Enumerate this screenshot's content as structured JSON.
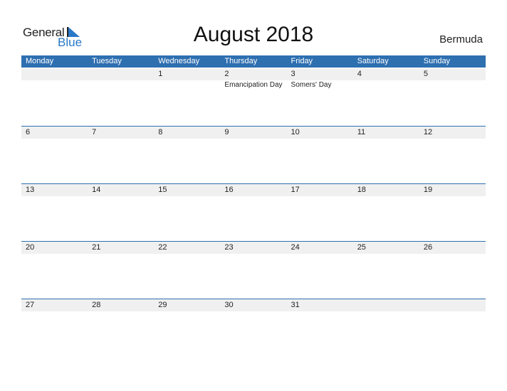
{
  "logo": {
    "word1": "General",
    "word2": "Blue"
  },
  "title": "August 2018",
  "country": "Bermuda",
  "colors": {
    "accent": "#2e6fb0",
    "strip": "#f0f0f0"
  },
  "weekdays": [
    "Monday",
    "Tuesday",
    "Wednesday",
    "Thursday",
    "Friday",
    "Saturday",
    "Sunday"
  ],
  "weeks": [
    [
      {
        "day": ""
      },
      {
        "day": ""
      },
      {
        "day": "1"
      },
      {
        "day": "2",
        "event": "Emancipation Day"
      },
      {
        "day": "3",
        "event": "Somers' Day"
      },
      {
        "day": "4"
      },
      {
        "day": "5"
      }
    ],
    [
      {
        "day": "6"
      },
      {
        "day": "7"
      },
      {
        "day": "8"
      },
      {
        "day": "9"
      },
      {
        "day": "10"
      },
      {
        "day": "11"
      },
      {
        "day": "12"
      }
    ],
    [
      {
        "day": "13"
      },
      {
        "day": "14"
      },
      {
        "day": "15"
      },
      {
        "day": "16"
      },
      {
        "day": "17"
      },
      {
        "day": "18"
      },
      {
        "day": "19"
      }
    ],
    [
      {
        "day": "20"
      },
      {
        "day": "21"
      },
      {
        "day": "22"
      },
      {
        "day": "23"
      },
      {
        "day": "24"
      },
      {
        "day": "25"
      },
      {
        "day": "26"
      }
    ],
    [
      {
        "day": "27"
      },
      {
        "day": "28"
      },
      {
        "day": "29"
      },
      {
        "day": "30"
      },
      {
        "day": "31"
      },
      {
        "day": ""
      },
      {
        "day": ""
      }
    ]
  ]
}
